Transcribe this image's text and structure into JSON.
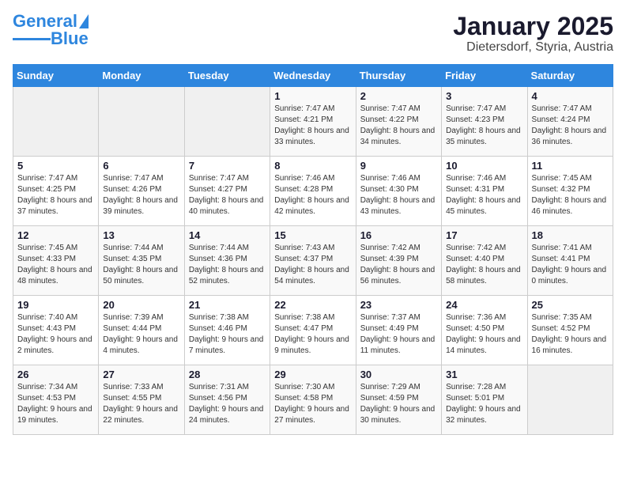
{
  "header": {
    "logo_general": "General",
    "logo_blue": "Blue",
    "month": "January 2025",
    "location": "Dietersdorf, Styria, Austria"
  },
  "days_of_week": [
    "Sunday",
    "Monday",
    "Tuesday",
    "Wednesday",
    "Thursday",
    "Friday",
    "Saturday"
  ],
  "weeks": [
    [
      {
        "day": "",
        "content": ""
      },
      {
        "day": "",
        "content": ""
      },
      {
        "day": "",
        "content": ""
      },
      {
        "day": "1",
        "content": "Sunrise: 7:47 AM\nSunset: 4:21 PM\nDaylight: 8 hours and 33 minutes."
      },
      {
        "day": "2",
        "content": "Sunrise: 7:47 AM\nSunset: 4:22 PM\nDaylight: 8 hours and 34 minutes."
      },
      {
        "day": "3",
        "content": "Sunrise: 7:47 AM\nSunset: 4:23 PM\nDaylight: 8 hours and 35 minutes."
      },
      {
        "day": "4",
        "content": "Sunrise: 7:47 AM\nSunset: 4:24 PM\nDaylight: 8 hours and 36 minutes."
      }
    ],
    [
      {
        "day": "5",
        "content": "Sunrise: 7:47 AM\nSunset: 4:25 PM\nDaylight: 8 hours and 37 minutes."
      },
      {
        "day": "6",
        "content": "Sunrise: 7:47 AM\nSunset: 4:26 PM\nDaylight: 8 hours and 39 minutes."
      },
      {
        "day": "7",
        "content": "Sunrise: 7:47 AM\nSunset: 4:27 PM\nDaylight: 8 hours and 40 minutes."
      },
      {
        "day": "8",
        "content": "Sunrise: 7:46 AM\nSunset: 4:28 PM\nDaylight: 8 hours and 42 minutes."
      },
      {
        "day": "9",
        "content": "Sunrise: 7:46 AM\nSunset: 4:30 PM\nDaylight: 8 hours and 43 minutes."
      },
      {
        "day": "10",
        "content": "Sunrise: 7:46 AM\nSunset: 4:31 PM\nDaylight: 8 hours and 45 minutes."
      },
      {
        "day": "11",
        "content": "Sunrise: 7:45 AM\nSunset: 4:32 PM\nDaylight: 8 hours and 46 minutes."
      }
    ],
    [
      {
        "day": "12",
        "content": "Sunrise: 7:45 AM\nSunset: 4:33 PM\nDaylight: 8 hours and 48 minutes."
      },
      {
        "day": "13",
        "content": "Sunrise: 7:44 AM\nSunset: 4:35 PM\nDaylight: 8 hours and 50 minutes."
      },
      {
        "day": "14",
        "content": "Sunrise: 7:44 AM\nSunset: 4:36 PM\nDaylight: 8 hours and 52 minutes."
      },
      {
        "day": "15",
        "content": "Sunrise: 7:43 AM\nSunset: 4:37 PM\nDaylight: 8 hours and 54 minutes."
      },
      {
        "day": "16",
        "content": "Sunrise: 7:42 AM\nSunset: 4:39 PM\nDaylight: 8 hours and 56 minutes."
      },
      {
        "day": "17",
        "content": "Sunrise: 7:42 AM\nSunset: 4:40 PM\nDaylight: 8 hours and 58 minutes."
      },
      {
        "day": "18",
        "content": "Sunrise: 7:41 AM\nSunset: 4:41 PM\nDaylight: 9 hours and 0 minutes."
      }
    ],
    [
      {
        "day": "19",
        "content": "Sunrise: 7:40 AM\nSunset: 4:43 PM\nDaylight: 9 hours and 2 minutes."
      },
      {
        "day": "20",
        "content": "Sunrise: 7:39 AM\nSunset: 4:44 PM\nDaylight: 9 hours and 4 minutes."
      },
      {
        "day": "21",
        "content": "Sunrise: 7:38 AM\nSunset: 4:46 PM\nDaylight: 9 hours and 7 minutes."
      },
      {
        "day": "22",
        "content": "Sunrise: 7:38 AM\nSunset: 4:47 PM\nDaylight: 9 hours and 9 minutes."
      },
      {
        "day": "23",
        "content": "Sunrise: 7:37 AM\nSunset: 4:49 PM\nDaylight: 9 hours and 11 minutes."
      },
      {
        "day": "24",
        "content": "Sunrise: 7:36 AM\nSunset: 4:50 PM\nDaylight: 9 hours and 14 minutes."
      },
      {
        "day": "25",
        "content": "Sunrise: 7:35 AM\nSunset: 4:52 PM\nDaylight: 9 hours and 16 minutes."
      }
    ],
    [
      {
        "day": "26",
        "content": "Sunrise: 7:34 AM\nSunset: 4:53 PM\nDaylight: 9 hours and 19 minutes."
      },
      {
        "day": "27",
        "content": "Sunrise: 7:33 AM\nSunset: 4:55 PM\nDaylight: 9 hours and 22 minutes."
      },
      {
        "day": "28",
        "content": "Sunrise: 7:31 AM\nSunset: 4:56 PM\nDaylight: 9 hours and 24 minutes."
      },
      {
        "day": "29",
        "content": "Sunrise: 7:30 AM\nSunset: 4:58 PM\nDaylight: 9 hours and 27 minutes."
      },
      {
        "day": "30",
        "content": "Sunrise: 7:29 AM\nSunset: 4:59 PM\nDaylight: 9 hours and 30 minutes."
      },
      {
        "day": "31",
        "content": "Sunrise: 7:28 AM\nSunset: 5:01 PM\nDaylight: 9 hours and 32 minutes."
      },
      {
        "day": "",
        "content": ""
      }
    ]
  ]
}
